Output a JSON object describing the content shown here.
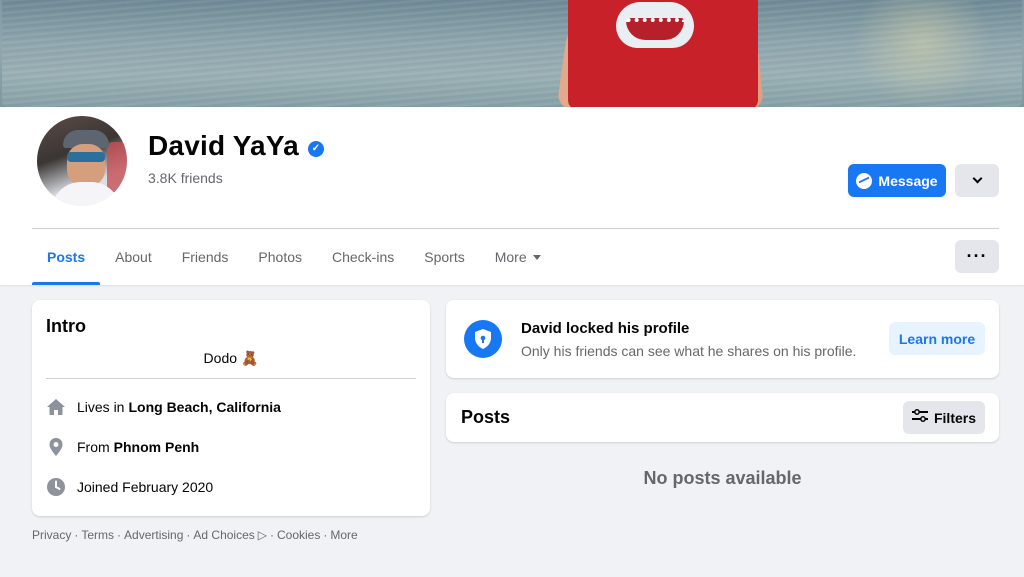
{
  "profile": {
    "name": "David YaYa",
    "friends": "3.8K friends",
    "verified_icon": "verified-check-icon"
  },
  "actions": {
    "message_label": "Message"
  },
  "tabs": [
    {
      "label": "Posts",
      "active": true
    },
    {
      "label": "About"
    },
    {
      "label": "Friends"
    },
    {
      "label": "Photos"
    },
    {
      "label": "Check-ins"
    },
    {
      "label": "Sports"
    },
    {
      "label": "More"
    }
  ],
  "more_dots": "···",
  "intro": {
    "title": "Intro",
    "bio": "Dodo",
    "bio_emoji": "🧸",
    "lives_prefix": "Lives in",
    "lives_value": "Long Beach, California",
    "from_prefix": "From",
    "from_value": "Phnom Penh",
    "joined": "Joined February 2020"
  },
  "locked": {
    "title": "David locked his profile",
    "subtitle": "Only his friends can see what he shares on his profile.",
    "button": "Learn more"
  },
  "posts": {
    "title": "Posts",
    "filters_label": "Filters",
    "empty": "No posts available"
  },
  "footer": {
    "links": [
      "Privacy",
      "Terms",
      "Advertising",
      "Ad Choices",
      "Cookies",
      "More"
    ],
    "separator": "·"
  },
  "colors": {
    "accent": "#1877f2",
    "background": "#f0f2f5",
    "secondary_text": "#65676b"
  }
}
